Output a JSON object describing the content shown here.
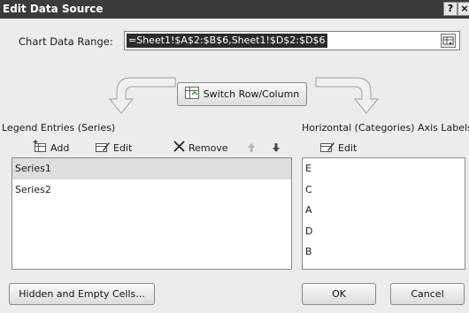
{
  "window": {
    "title": "Edit Data Source",
    "help_label": "?",
    "close_label": "×"
  },
  "range": {
    "label": "Chart Data Range:",
    "value": "=Sheet1!$A$2:$B$6,Sheet1!$D$2:$D$6"
  },
  "switch_button": {
    "label": "Switch Row/Column"
  },
  "legend": {
    "label": "Legend Entries (Series)",
    "add_label": "Add",
    "edit_label": "Edit",
    "remove_label": "Remove",
    "series": [
      {
        "label": "Series1",
        "selected": true
      },
      {
        "label": "Series2",
        "selected": false
      }
    ]
  },
  "axis": {
    "label": "Horizontal (Categories) Axis Labels",
    "edit_label": "Edit",
    "categories": [
      "E",
      "C",
      "A",
      "D",
      "B"
    ]
  },
  "footer": {
    "hidden_label": "Hidden and Empty Cells...",
    "ok_label": "OK",
    "cancel_label": "Cancel"
  },
  "colors": {
    "titlebar": "#3b3b3b",
    "dialog_bg": "#ececec",
    "selection": "#2b2b2b",
    "selected_row": "#dedede"
  },
  "icons": [
    "switch-row-column-icon",
    "add-series-icon",
    "edit-series-icon",
    "remove-series-icon",
    "move-up-icon",
    "move-down-icon",
    "edit-axis-icon",
    "collapse-dialog-icon",
    "left-curved-arrow",
    "right-curved-arrow"
  ]
}
